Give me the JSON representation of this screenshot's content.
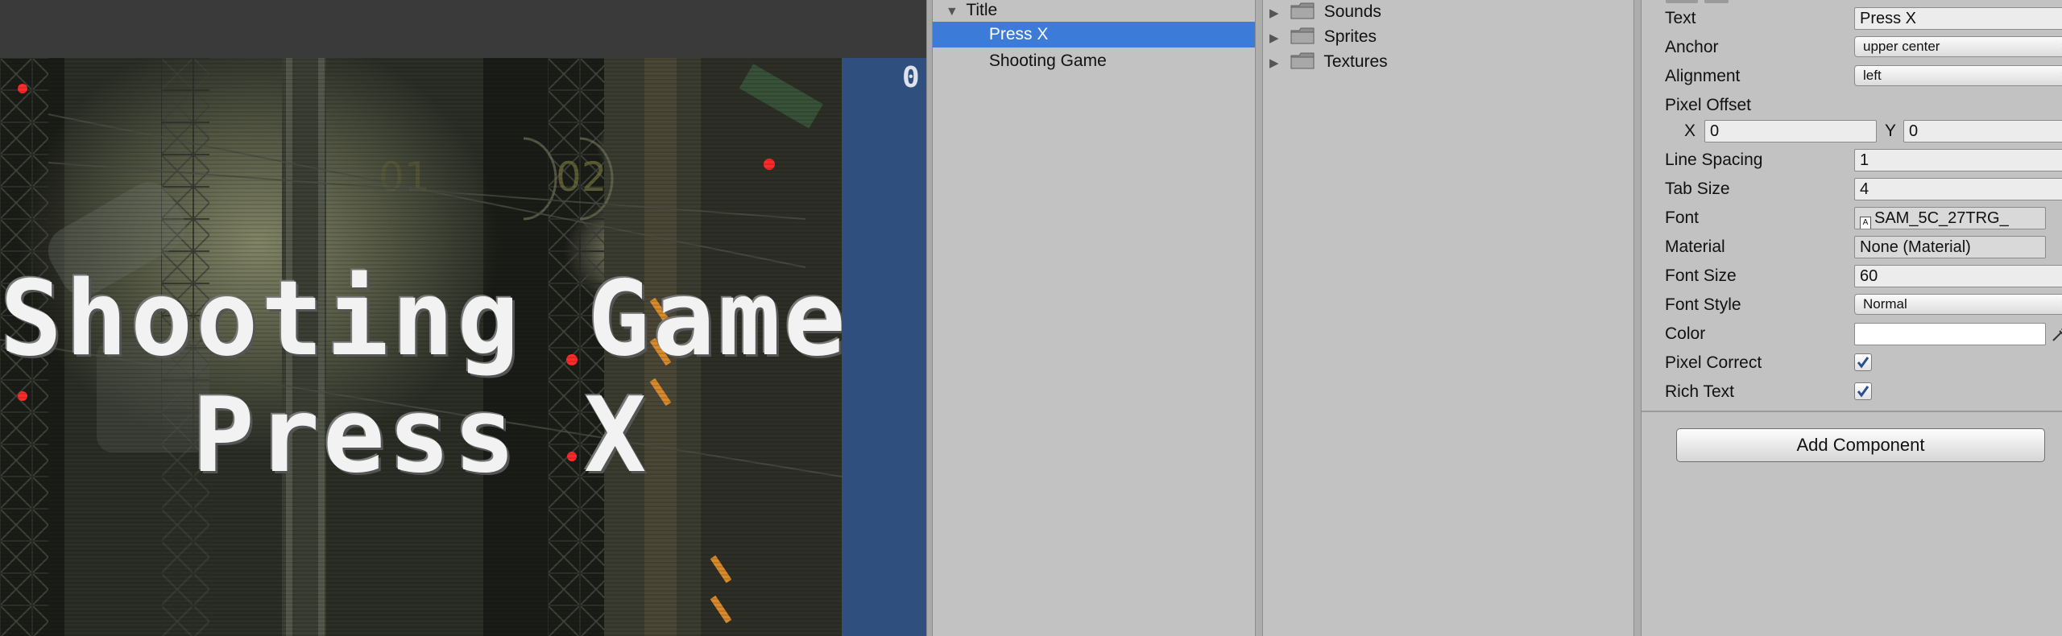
{
  "game_view": {
    "title_line1": "Shooting Game",
    "title_line2": "Press X",
    "sidebar_digit": "0",
    "background_color": "#151712",
    "sidebar_color": "#2f4f7e"
  },
  "hierarchy": {
    "items": [
      {
        "label": "Title",
        "indent": 0,
        "expanded": true,
        "selected": false
      },
      {
        "label": "Press X",
        "indent": 1,
        "expanded": false,
        "selected": true
      },
      {
        "label": "Shooting Game",
        "indent": 1,
        "expanded": false,
        "selected": false
      }
    ],
    "selection_color": "#3d7bd9"
  },
  "project": {
    "folders": [
      {
        "label": "Sounds",
        "icon": "folder-icon"
      },
      {
        "label": "Sprites",
        "icon": "folder-icon"
      },
      {
        "label": "Textures",
        "icon": "folder-icon"
      }
    ]
  },
  "inspector": {
    "text_label": "Text",
    "text_value": "Press X",
    "anchor_label": "Anchor",
    "anchor_value": "upper center",
    "alignment_label": "Alignment",
    "alignment_value": "left",
    "pixel_offset_label": "Pixel Offset",
    "pixel_offset_x_label": "X",
    "pixel_offset_x_value": "0",
    "pixel_offset_y_label": "Y",
    "pixel_offset_y_value": "0",
    "line_spacing_label": "Line Spacing",
    "line_spacing_value": "1",
    "tab_size_label": "Tab Size",
    "tab_size_value": "4",
    "font_label": "Font",
    "font_value": "SAM_5C_27TRG_",
    "material_label": "Material",
    "material_value": "None (Material)",
    "font_size_label": "Font Size",
    "font_size_value": "60",
    "font_style_label": "Font Style",
    "font_style_value": "Normal",
    "color_label": "Color",
    "color_value": "#ffffff",
    "pixel_correct_label": "Pixel Correct",
    "pixel_correct_checked": true,
    "rich_text_label": "Rich Text",
    "rich_text_checked": true,
    "add_component_label": "Add Component"
  }
}
